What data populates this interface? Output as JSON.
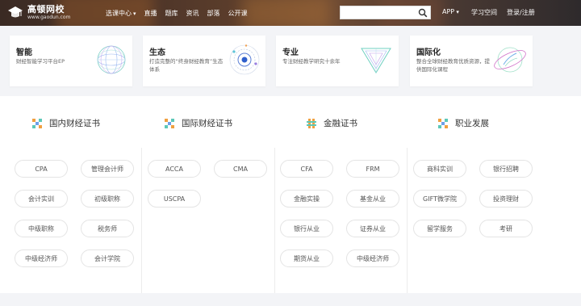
{
  "header": {
    "logo_cn": "高顿网校",
    "logo_en": "www.gaodun.com",
    "nav": [
      "选课中心",
      "直播",
      "题库",
      "资讯",
      "部落",
      "公开课"
    ],
    "search_placeholder": "",
    "app_label": "APP",
    "study_label": "学习空间",
    "login_label": "登录/注册"
  },
  "cards": [
    {
      "title": "智能",
      "desc": "财经智能学习平台EP",
      "art": "sphere-icon"
    },
    {
      "title": "生态",
      "desc": "打造完整的“终身财经教育”生态体系",
      "art": "orbit-icon"
    },
    {
      "title": "专业",
      "desc": "专注财经教学研究十余年",
      "art": "triangle-icon"
    },
    {
      "title": "国际化",
      "desc": "整合全球财经教育优质资源，提供国际化课程",
      "art": "globe-icon"
    }
  ],
  "columns": [
    {
      "title": "国内财经证书",
      "pills": [
        "CPA",
        "管理会计师",
        "会计实训",
        "初级职称",
        "中级职称",
        "税务师",
        "中级经济师",
        "会计学院"
      ]
    },
    {
      "title": "国际财经证书",
      "pills": [
        "ACCA",
        "CMA",
        "USCPA"
      ]
    },
    {
      "title": "金融证书",
      "pills": [
        "CFA",
        "FRM",
        "金融实操",
        "基金从业",
        "银行从业",
        "证券从业",
        "期货从业",
        "中级经济师"
      ]
    },
    {
      "title": "职业发展",
      "pills": [
        "商科实训",
        "银行招聘",
        "GIFT微学院",
        "投资理财",
        "留学服务",
        "考研"
      ]
    }
  ],
  "colors": {
    "accent": "#f08a24",
    "topbar": "#4a3328",
    "border": "#e4e4e4"
  }
}
